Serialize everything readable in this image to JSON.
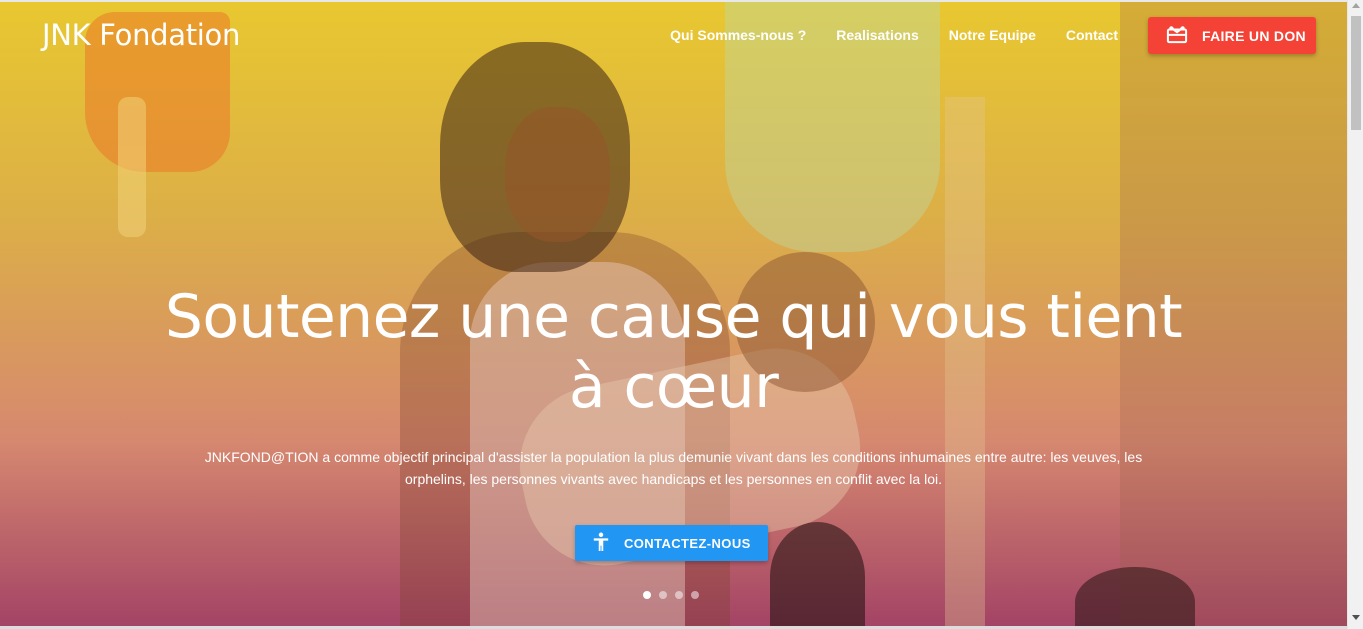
{
  "brand": {
    "name": "JNK Fondation"
  },
  "nav": {
    "links": [
      "Qui Sommes-nous ?",
      "Realisations",
      "Notre Equipe",
      "Contact"
    ],
    "donate_label": "FAIRE UN DON"
  },
  "hero": {
    "title": "Soutenez une cause qui vous tient à cœur",
    "description": "JNKFOND@TION a comme objectif principal d'assister la population la plus demunie vivant dans les conditions inhumaines entre autre: les veuves, les orphelins, les personnes vivants avec handicaps et les personnes en conflit avec la loi.",
    "cta_label": "CONTACTEZ-NOUS",
    "slides_total": 4,
    "active_slide": 1
  },
  "colors": {
    "donate": "#f44336",
    "cta": "#2196f3",
    "overlay_top": "#e6c31e",
    "overlay_bottom": "#962850"
  },
  "icons": {
    "donate": "gift-card-icon",
    "cta": "accessibility-icon"
  }
}
